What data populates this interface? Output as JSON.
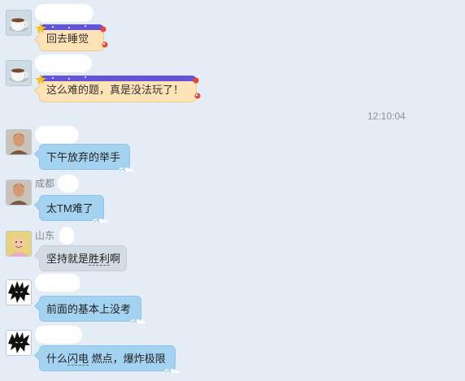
{
  "timestamp": "12:10:04",
  "messages": [
    {
      "name": "",
      "text": "回去睡觉"
    },
    {
      "name": "",
      "text": "这么难的题，真是没法玩了！"
    },
    {
      "name": "",
      "text": "下午放弃的举手"
    },
    {
      "name": "成都",
      "text": "太TM难了"
    },
    {
      "name": "山东",
      "text_pre": "坚持就是",
      "text_dashed": "胜利",
      "text_post": "啊"
    },
    {
      "name": "",
      "text": "前面的基本上没考"
    },
    {
      "name": "",
      "text_pre": "什么",
      "text_dashed": "闪电",
      "text_post": " 燃点，爆炸极限"
    }
  ],
  "avatars": [
    "coffee-cup-icon",
    "coffee-cup-icon",
    "man-photo-icon",
    "man-photo-icon",
    "baby-photo-icon",
    "anime-spiky-hair-icon",
    "anime-spiky-hair-icon"
  ],
  "colors": {
    "background": "#e4ecf5",
    "bubble_blue": "#a4d3f2",
    "bubble_grey": "#d3dbe4",
    "bubble_theme": "#fde3b6",
    "theme_band": "#6454d8"
  }
}
